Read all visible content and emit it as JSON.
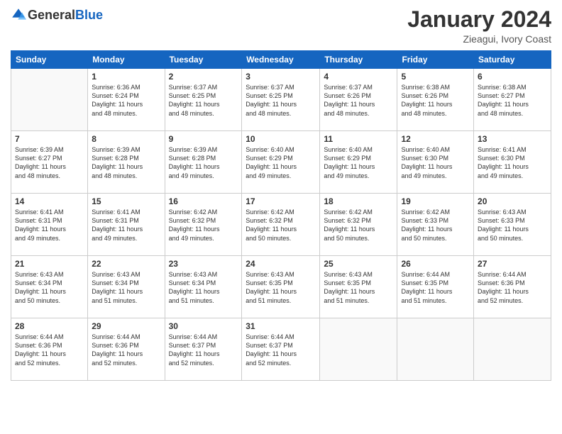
{
  "logo": {
    "general": "General",
    "blue": "Blue"
  },
  "header": {
    "month": "January 2024",
    "location": "Zieagui, Ivory Coast"
  },
  "weekdays": [
    "Sunday",
    "Monday",
    "Tuesday",
    "Wednesday",
    "Thursday",
    "Friday",
    "Saturday"
  ],
  "weeks": [
    [
      {
        "day": "",
        "info": ""
      },
      {
        "day": "1",
        "info": "Sunrise: 6:36 AM\nSunset: 6:24 PM\nDaylight: 11 hours\nand 48 minutes."
      },
      {
        "day": "2",
        "info": "Sunrise: 6:37 AM\nSunset: 6:25 PM\nDaylight: 11 hours\nand 48 minutes."
      },
      {
        "day": "3",
        "info": "Sunrise: 6:37 AM\nSunset: 6:25 PM\nDaylight: 11 hours\nand 48 minutes."
      },
      {
        "day": "4",
        "info": "Sunrise: 6:37 AM\nSunset: 6:26 PM\nDaylight: 11 hours\nand 48 minutes."
      },
      {
        "day": "5",
        "info": "Sunrise: 6:38 AM\nSunset: 6:26 PM\nDaylight: 11 hours\nand 48 minutes."
      },
      {
        "day": "6",
        "info": "Sunrise: 6:38 AM\nSunset: 6:27 PM\nDaylight: 11 hours\nand 48 minutes."
      }
    ],
    [
      {
        "day": "7",
        "info": "Sunrise: 6:39 AM\nSunset: 6:27 PM\nDaylight: 11 hours\nand 48 minutes."
      },
      {
        "day": "8",
        "info": "Sunrise: 6:39 AM\nSunset: 6:28 PM\nDaylight: 11 hours\nand 48 minutes."
      },
      {
        "day": "9",
        "info": "Sunrise: 6:39 AM\nSunset: 6:28 PM\nDaylight: 11 hours\nand 49 minutes."
      },
      {
        "day": "10",
        "info": "Sunrise: 6:40 AM\nSunset: 6:29 PM\nDaylight: 11 hours\nand 49 minutes."
      },
      {
        "day": "11",
        "info": "Sunrise: 6:40 AM\nSunset: 6:29 PM\nDaylight: 11 hours\nand 49 minutes."
      },
      {
        "day": "12",
        "info": "Sunrise: 6:40 AM\nSunset: 6:30 PM\nDaylight: 11 hours\nand 49 minutes."
      },
      {
        "day": "13",
        "info": "Sunrise: 6:41 AM\nSunset: 6:30 PM\nDaylight: 11 hours\nand 49 minutes."
      }
    ],
    [
      {
        "day": "14",
        "info": "Sunrise: 6:41 AM\nSunset: 6:31 PM\nDaylight: 11 hours\nand 49 minutes."
      },
      {
        "day": "15",
        "info": "Sunrise: 6:41 AM\nSunset: 6:31 PM\nDaylight: 11 hours\nand 49 minutes."
      },
      {
        "day": "16",
        "info": "Sunrise: 6:42 AM\nSunset: 6:32 PM\nDaylight: 11 hours\nand 49 minutes."
      },
      {
        "day": "17",
        "info": "Sunrise: 6:42 AM\nSunset: 6:32 PM\nDaylight: 11 hours\nand 50 minutes."
      },
      {
        "day": "18",
        "info": "Sunrise: 6:42 AM\nSunset: 6:32 PM\nDaylight: 11 hours\nand 50 minutes."
      },
      {
        "day": "19",
        "info": "Sunrise: 6:42 AM\nSunset: 6:33 PM\nDaylight: 11 hours\nand 50 minutes."
      },
      {
        "day": "20",
        "info": "Sunrise: 6:43 AM\nSunset: 6:33 PM\nDaylight: 11 hours\nand 50 minutes."
      }
    ],
    [
      {
        "day": "21",
        "info": "Sunrise: 6:43 AM\nSunset: 6:34 PM\nDaylight: 11 hours\nand 50 minutes."
      },
      {
        "day": "22",
        "info": "Sunrise: 6:43 AM\nSunset: 6:34 PM\nDaylight: 11 hours\nand 51 minutes."
      },
      {
        "day": "23",
        "info": "Sunrise: 6:43 AM\nSunset: 6:34 PM\nDaylight: 11 hours\nand 51 minutes."
      },
      {
        "day": "24",
        "info": "Sunrise: 6:43 AM\nSunset: 6:35 PM\nDaylight: 11 hours\nand 51 minutes."
      },
      {
        "day": "25",
        "info": "Sunrise: 6:43 AM\nSunset: 6:35 PM\nDaylight: 11 hours\nand 51 minutes."
      },
      {
        "day": "26",
        "info": "Sunrise: 6:44 AM\nSunset: 6:35 PM\nDaylight: 11 hours\nand 51 minutes."
      },
      {
        "day": "27",
        "info": "Sunrise: 6:44 AM\nSunset: 6:36 PM\nDaylight: 11 hours\nand 52 minutes."
      }
    ],
    [
      {
        "day": "28",
        "info": "Sunrise: 6:44 AM\nSunset: 6:36 PM\nDaylight: 11 hours\nand 52 minutes."
      },
      {
        "day": "29",
        "info": "Sunrise: 6:44 AM\nSunset: 6:36 PM\nDaylight: 11 hours\nand 52 minutes."
      },
      {
        "day": "30",
        "info": "Sunrise: 6:44 AM\nSunset: 6:37 PM\nDaylight: 11 hours\nand 52 minutes."
      },
      {
        "day": "31",
        "info": "Sunrise: 6:44 AM\nSunset: 6:37 PM\nDaylight: 11 hours\nand 52 minutes."
      },
      {
        "day": "",
        "info": ""
      },
      {
        "day": "",
        "info": ""
      },
      {
        "day": "",
        "info": ""
      }
    ]
  ]
}
